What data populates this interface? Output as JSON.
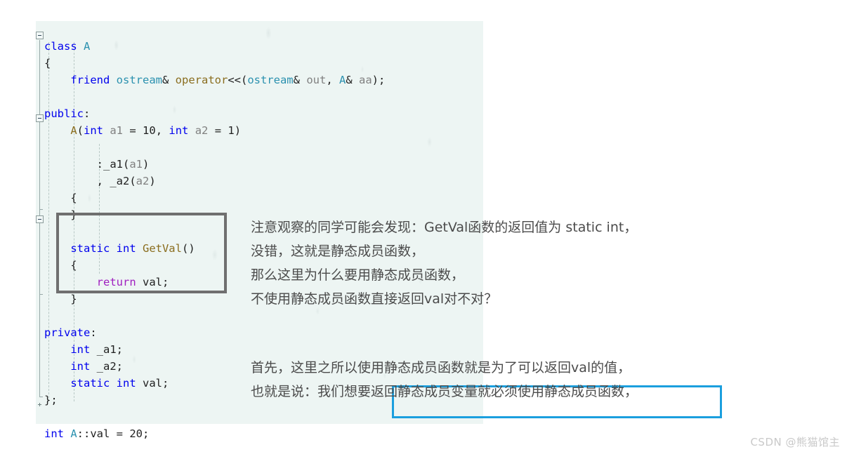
{
  "code_panel": {
    "background_color": "#edf5f3",
    "language": "cpp",
    "lines": [
      {
        "indent": 0,
        "fold": "minus",
        "tokens": [
          {
            "t": "class ",
            "c": "kw"
          },
          {
            "t": "A",
            "c": "typ"
          }
        ]
      },
      {
        "indent": 0,
        "fold": "none",
        "tokens": [
          {
            "t": "{",
            "c": "pln"
          }
        ]
      },
      {
        "indent": 1,
        "fold": "none",
        "tokens": [
          {
            "t": "friend ",
            "c": "kw"
          },
          {
            "t": "ostream",
            "c": "typ"
          },
          {
            "t": "& ",
            "c": "pln"
          },
          {
            "t": "operator",
            "c": "fn"
          },
          {
            "t": "<<(",
            "c": "pln"
          },
          {
            "t": "ostream",
            "c": "typ"
          },
          {
            "t": "& ",
            "c": "pln"
          },
          {
            "t": "out",
            "c": "id"
          },
          {
            "t": ", ",
            "c": "pln"
          },
          {
            "t": "A",
            "c": "typ"
          },
          {
            "t": "& ",
            "c": "pln"
          },
          {
            "t": "aa",
            "c": "id"
          },
          {
            "t": ");",
            "c": "pln"
          }
        ]
      },
      {
        "indent": 0,
        "fold": "none",
        "tokens": []
      },
      {
        "indent": 0,
        "fold": "none",
        "tokens": [
          {
            "t": "public",
            "c": "kw"
          },
          {
            "t": ":",
            "c": "pln"
          }
        ]
      },
      {
        "indent": 1,
        "fold": "minus",
        "tokens": [
          {
            "t": "A",
            "c": "fn"
          },
          {
            "t": "(",
            "c": "pln"
          },
          {
            "t": "int ",
            "c": "kw"
          },
          {
            "t": "a1",
            "c": "id"
          },
          {
            "t": " = ",
            "c": "pln"
          },
          {
            "t": "10",
            "c": "pln"
          },
          {
            "t": ", ",
            "c": "pln"
          },
          {
            "t": "int ",
            "c": "kw"
          },
          {
            "t": "a2",
            "c": "id"
          },
          {
            "t": " = ",
            "c": "pln"
          },
          {
            "t": "1",
            "c": "pln"
          },
          {
            "t": ")",
            "c": "pln"
          }
        ]
      },
      {
        "indent": 0,
        "fold": "none",
        "tokens": []
      },
      {
        "indent": 2,
        "fold": "none",
        "tokens": [
          {
            "t": ":_a1(",
            "c": "pln"
          },
          {
            "t": "a1",
            "c": "id"
          },
          {
            "t": ")",
            "c": "pln"
          }
        ]
      },
      {
        "indent": 2,
        "fold": "none",
        "tokens": [
          {
            "t": ", _a2(",
            "c": "pln"
          },
          {
            "t": "a2",
            "c": "id"
          },
          {
            "t": ")",
            "c": "pln"
          }
        ]
      },
      {
        "indent": 1,
        "fold": "none",
        "tokens": [
          {
            "t": "{",
            "c": "pln"
          }
        ]
      },
      {
        "indent": 1,
        "fold": "none",
        "tokens": [
          {
            "t": "}",
            "c": "pln"
          }
        ]
      },
      {
        "indent": 0,
        "fold": "none",
        "tokens": []
      },
      {
        "indent": 1,
        "fold": "minus",
        "tokens": [
          {
            "t": "static int ",
            "c": "kw"
          },
          {
            "t": "GetVal",
            "c": "fn"
          },
          {
            "t": "()",
            "c": "pln"
          }
        ]
      },
      {
        "indent": 1,
        "fold": "none",
        "tokens": [
          {
            "t": "{",
            "c": "pln"
          }
        ]
      },
      {
        "indent": 2,
        "fold": "none",
        "tokens": [
          {
            "t": "return ",
            "c": "ctl"
          },
          {
            "t": "val;",
            "c": "pln"
          }
        ]
      },
      {
        "indent": 1,
        "fold": "none",
        "tokens": [
          {
            "t": "}",
            "c": "pln"
          }
        ]
      },
      {
        "indent": 0,
        "fold": "none",
        "tokens": []
      },
      {
        "indent": 0,
        "fold": "none",
        "tokens": [
          {
            "t": "private",
            "c": "kw"
          },
          {
            "t": ":",
            "c": "pln"
          }
        ]
      },
      {
        "indent": 1,
        "fold": "none",
        "tokens": [
          {
            "t": "int ",
            "c": "kw"
          },
          {
            "t": "_a1;",
            "c": "pln"
          }
        ]
      },
      {
        "indent": 1,
        "fold": "none",
        "tokens": [
          {
            "t": "int ",
            "c": "kw"
          },
          {
            "t": "_a2;",
            "c": "pln"
          }
        ]
      },
      {
        "indent": 1,
        "fold": "none",
        "tokens": [
          {
            "t": "static int ",
            "c": "kw"
          },
          {
            "t": "val;",
            "c": "pln"
          }
        ]
      },
      {
        "indent": 0,
        "fold": "none",
        "tokens": [
          {
            "t": "};",
            "c": "pln"
          }
        ]
      },
      {
        "indent": 0,
        "fold": "none",
        "tokens": []
      },
      {
        "indent": 0,
        "fold": "none",
        "tokens": [
          {
            "t": "int ",
            "c": "kw"
          },
          {
            "t": "A",
            "c": "typ"
          },
          {
            "t": "::val = ",
            "c": "pln"
          },
          {
            "t": "20",
            "c": "pln"
          },
          {
            "t": ";",
            "c": "pln"
          }
        ]
      }
    ],
    "plain_text": "class A\n{\n    friend ostream& operator<<(ostream& out, A& aa);\n\npublic:\n    A(int a1 = 10, int a2 = 1)\n\n        :_a1(a1)\n        , _a2(a2)\n    {\n    }\n\n    static int GetVal()\n    {\n        return val;\n    }\n\nprivate:\n    int _a1;\n    int _a2;\n    static int val;\n};\n\nint A::val = 20;"
  },
  "gray_callout": {
    "label": "gray-highlight-box-around-getval",
    "color": "#6f6f6f",
    "encloses": "static int GetVal() { return val; }"
  },
  "blue_callout": {
    "label": "blue-highlight-box",
    "color": "#1b9fde",
    "encloses": "返回静态成员变量就必须使用静态成员函数，"
  },
  "annotations": {
    "block1": [
      "注意观察的同学可能会发现：GetVal函数的返回值为 static int，",
      "没错，这就是静态成员函数，",
      "那么这里为什么要用静态成员函数，",
      "不使用静态成员函数直接返回val对不对？"
    ],
    "block2": [
      "首先，这里之所以使用静态成员函数就是为了可以返回val的值，",
      "也就是说：我们想要返回静态成员变量就必须使用静态成员函数，"
    ],
    "text_color": "#4b4b4b"
  },
  "watermark": {
    "text": "CSDN @熊猫馆主",
    "color": "#c9c9c9"
  }
}
